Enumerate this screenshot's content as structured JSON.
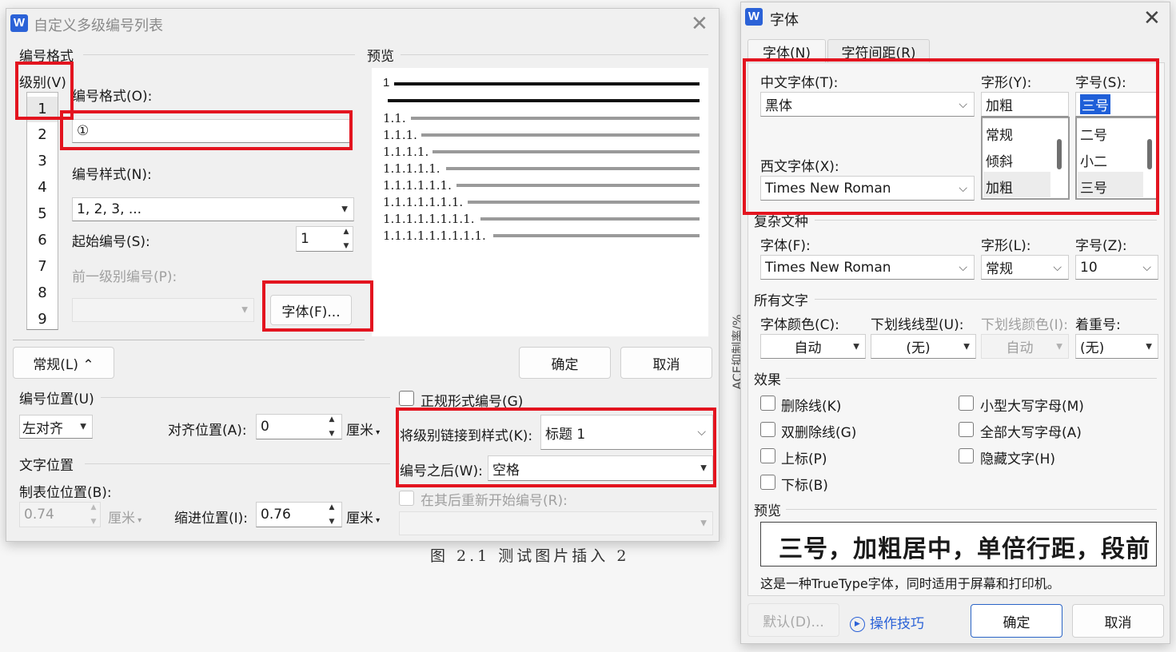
{
  "left_dialog": {
    "title": "自定义多级编号列表",
    "format_group": "编号格式",
    "level_label": "级别(V)",
    "levels": [
      "1",
      "2",
      "3",
      "4",
      "5",
      "6",
      "7",
      "8",
      "9"
    ],
    "format_label": "编号格式(O):",
    "format_value": "①",
    "style_label": "编号样式(N):",
    "style_value": "1, 2, 3, ...",
    "start_label": "起始编号(S):",
    "start_value": "1",
    "prev_level_label": "前一级别编号(P):",
    "font_button": "字体(F)...",
    "preview_label": "预览",
    "preview_items": [
      "1",
      "1.1.",
      "1.1.1.",
      "1.1.1.1.",
      "1.1.1.1.1.",
      "1.1.1.1.1.1.",
      "1.1.1.1.1.1.1.",
      "1.1.1.1.1.1.1.1.",
      "1.1.1.1.1.1.1.1.1."
    ],
    "general_button": "常规(L) ⌃",
    "ok": "确定",
    "cancel": "取消",
    "num_pos_label": "编号位置(U)",
    "num_pos_value": "左对齐",
    "align_label": "对齐位置(A):",
    "align_value": "0",
    "unit": "厘米",
    "text_pos_label": "文字位置",
    "tab_label": "制表位位置(B):",
    "tab_value": "0.74",
    "indent_label": "缩进位置(I):",
    "indent_value": "0.76",
    "legal_label": "正规形式编号(G)",
    "link_label": "将级别链接到样式(K):",
    "link_value": "标题 1",
    "after_label": "编号之后(W):",
    "after_value": "空格",
    "restart_label": "在其后重新开始编号(R):"
  },
  "caption": "图 2.1 测试图片插入 2",
  "right_dialog": {
    "title": "字体",
    "tabs": [
      "字体(N)",
      "字符间距(R)"
    ],
    "cn_font_label": "中文字体(T):",
    "cn_font_value": "黑体",
    "style_label": "字形(Y):",
    "style_value": "加粗",
    "style_options": [
      "常规",
      "倾斜",
      "加粗"
    ],
    "size_label": "字号(S):",
    "size_value": "三号",
    "size_options": [
      "二号",
      "小二",
      "三号"
    ],
    "west_font_label": "西文字体(X):",
    "west_font_value": "Times New Roman",
    "complex_group": "复杂文种",
    "complex_font_label": "字体(F):",
    "complex_font_value": "Times New Roman",
    "complex_style_label": "字形(L):",
    "complex_style_value": "常规",
    "complex_size_label": "字号(Z):",
    "complex_size_value": "10",
    "all_text_group": "所有文字",
    "color_label": "字体颜色(C):",
    "color_value": "自动",
    "underline_label": "下划线线型(U):",
    "underline_value": "(无)",
    "underline_color_label": "下划线颜色(I):",
    "underline_color_value": "自动",
    "emphasis_label": "着重号:",
    "emphasis_value": "(无)",
    "effects_group": "效果",
    "effects_left": [
      "删除线(K)",
      "双删除线(G)",
      "上标(P)",
      "下标(B)"
    ],
    "effects_right": [
      "小型大写字母(M)",
      "全部大写字母(A)",
      "隐藏文字(H)"
    ],
    "preview_group": "预览",
    "preview_text": "三号，加粗居中，单倍行距，段前",
    "font_note": "这是一种TrueType字体，同时适用于屏幕和打印机。",
    "default_button": "默认(D)...",
    "tips_link": "操作技巧",
    "ok": "确定",
    "cancel": "取消"
  },
  "side_text": "ACE抑制率/%"
}
